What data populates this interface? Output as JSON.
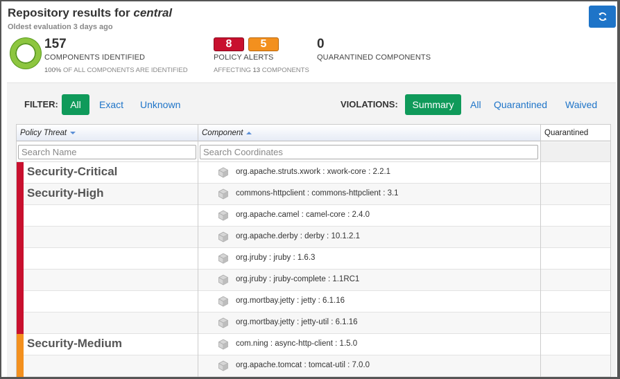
{
  "header": {
    "title_prefix": "Repository results for",
    "title_repo": "central",
    "subtitle": "Oldest evaluation 3 days ago"
  },
  "stats": {
    "components": {
      "count": "157",
      "label": "COMPONENTS IDENTIFIED",
      "sub_pct": "100%",
      "sub_text": "OF ALL COMPONENTS ARE IDENTIFIED"
    },
    "alerts": {
      "red_count": "8",
      "orange_count": "5",
      "label": "POLICY ALERTS",
      "sub_prefix": "AFFECTING",
      "sub_count": "13",
      "sub_suffix": "COMPONENTS"
    },
    "quarantined": {
      "count": "0",
      "label": "QUARANTINED COMPONENTS"
    }
  },
  "filter": {
    "label": "FILTER:",
    "options": [
      "All",
      "Exact",
      "Unknown"
    ],
    "active": "All"
  },
  "violations": {
    "label": "VIOLATIONS:",
    "options": [
      "Summary",
      "All",
      "Quarantined",
      "Waived"
    ],
    "active": "Summary"
  },
  "table": {
    "columns": {
      "threat": "Policy Threat",
      "component": "Component",
      "quarantined": "Quarantined"
    },
    "search": {
      "name_placeholder": "Search Name",
      "coords_placeholder": "Search Coordinates"
    },
    "rows": [
      {
        "threat": "Security-Critical",
        "component": "org.apache.struts.xwork : xwork-core : 2.2.1"
      },
      {
        "threat": "Security-High",
        "component": "commons-httpclient : commons-httpclient : 3.1"
      },
      {
        "threat": "",
        "component": "org.apache.camel : camel-core : 2.4.0"
      },
      {
        "threat": "",
        "component": "org.apache.derby : derby : 10.1.2.1"
      },
      {
        "threat": "",
        "component": "org.jruby : jruby : 1.6.3"
      },
      {
        "threat": "",
        "component": "org.jruby : jruby-complete : 1.1RC1"
      },
      {
        "threat": "",
        "component": "org.mortbay.jetty : jetty : 6.1.16"
      },
      {
        "threat": "",
        "component": "org.mortbay.jetty : jetty-util : 6.1.16"
      },
      {
        "threat": "Security-Medium",
        "component": "com.ning : async-http-client : 1.5.0"
      },
      {
        "threat": "",
        "component": "org.apache.tomcat : tomcat-util : 7.0.0"
      }
    ]
  },
  "colors": {
    "critical": "#c8102e",
    "high": "#c8102e",
    "medium": "#f3901e",
    "accent_green": "#0f9a5a",
    "link_blue": "#1e74c8"
  },
  "icons": {
    "refresh": "refresh-icon",
    "component": "package-cube-icon"
  }
}
